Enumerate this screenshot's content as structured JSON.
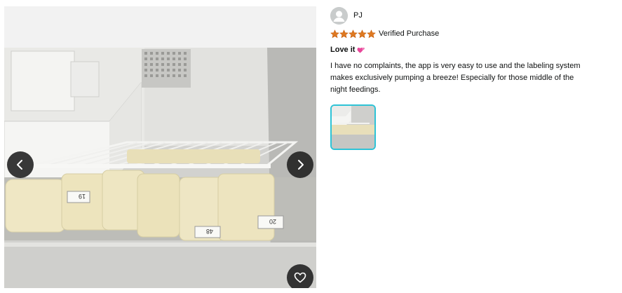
{
  "reviewer": {
    "name": "PJ",
    "avatar_icon": "default-user-icon"
  },
  "rating": {
    "stars": 5,
    "max_stars": 5,
    "star_color": "#de7921",
    "badge": "Verified Purchase"
  },
  "review": {
    "title": "Love it",
    "title_emoji": "two-hearts-icon",
    "body": "I have no complaints, the app is very easy to use and the labeling system makes exclusively pumping a breeze! Especially for those middle of the night feedings."
  },
  "media": {
    "prev_icon": "chevron-left-icon",
    "next_icon": "chevron-right-icon",
    "favorite_icon": "heart-icon",
    "thumbnail_border_color": "#2ec3d6",
    "bag_labels": [
      "19",
      "48",
      "20"
    ]
  }
}
